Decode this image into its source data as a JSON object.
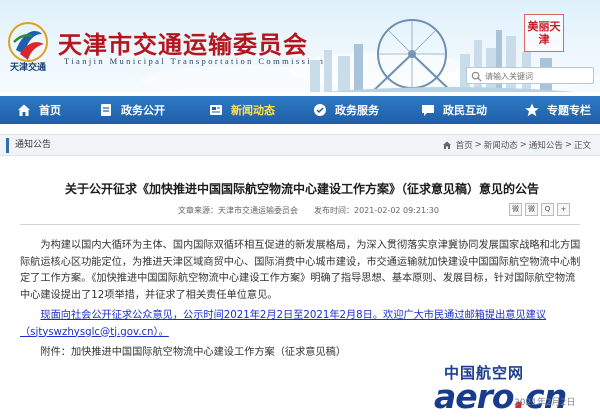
{
  "header": {
    "site_title": "天津市交通运输委员会",
    "site_subtitle": "Tianjin Municipal Transportation Commission",
    "logo_text": "天津交通",
    "seal_text": "美丽天津",
    "seal_caption": "",
    "search_placeholder": "请输入关键词"
  },
  "nav": {
    "items": [
      {
        "label": "首页",
        "icon": "home-icon",
        "active": false
      },
      {
        "label": "政务公开",
        "icon": "document-icon",
        "active": false
      },
      {
        "label": "新闻动态",
        "icon": "news-icon",
        "active": true
      },
      {
        "label": "政务服务",
        "icon": "service-icon",
        "active": false
      },
      {
        "label": "政民互动",
        "icon": "chat-icon",
        "active": false
      },
      {
        "label": "专题专栏",
        "icon": "star-icon",
        "active": false
      }
    ],
    "active_color": "#ffe34a",
    "bar_color": "#1e5fa8"
  },
  "breadcrumb": {
    "section": "通知公告",
    "path": [
      "首页",
      "新闻动态",
      "通知公告",
      "正文"
    ],
    "separator": ">"
  },
  "article": {
    "title": "关于公开征求《加快推进中国国际航空物流中心建设工作方案》（征求意见稿）意见的公告",
    "source_label": "文章来源：",
    "source": "天津市交通运输委员会",
    "time_label": "发布时间：",
    "time": "2021-02-02 09:21:30",
    "paragraph1": "为构建以国内大循环为主体、国内国际双循环相互促进的新发展格局，为深入贯彻落实京津冀协同发展国家战略和北方国际航运核心区功能定位，为推进天津区域商贸中心、国际消费中心城市建设，市交通运输就加快建设中国国际航空物流中心制定了工作方案。《加快推进中国国际航空物流中心建设工作方案》明确了指导思想、基本原则、发展目标，针对国际航空物流中心建设提出了12项举措，并征求了相关责任单位意见。",
    "paragraph2": "现面向社会公开征求公众意见，公示时间2021年2月2日至2021年2月8日。欢迎广大市民通过邮箱提出意见建议（sjtyswzhysglc@tj.gov.cn）。",
    "paragraph3": "附件：加快推进中国国际航空物流中心建设工作方案（征求意见稿）",
    "share_buttons": [
      "微",
      "微",
      "Q",
      "+"
    ]
  },
  "watermark": {
    "cn": "中国航空网",
    "en_prefix": "aero",
    "en_dot": ".",
    "en_suffix": "cn",
    "date": "2021年2月2日"
  }
}
